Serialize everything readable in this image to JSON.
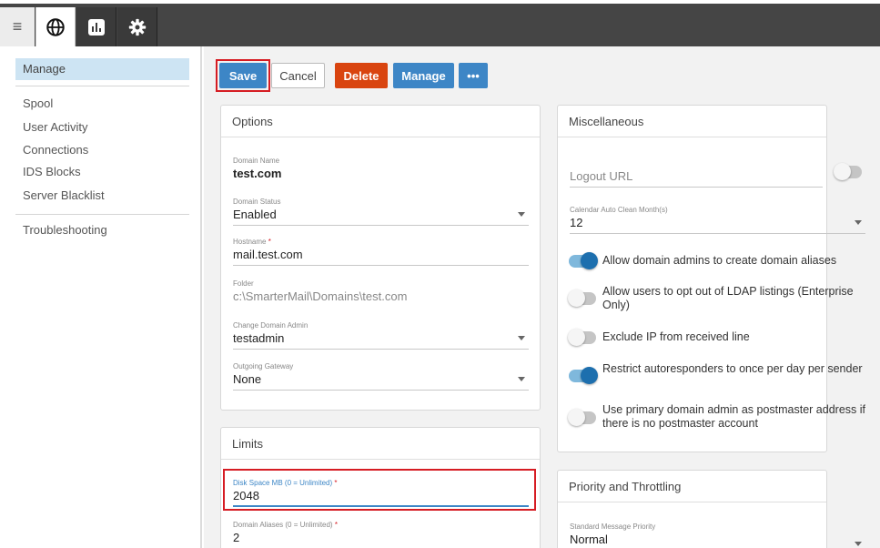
{
  "topbar": {
    "tabs": [
      {
        "name": "domains",
        "icon": "globe-icon",
        "active": true
      },
      {
        "name": "reports",
        "icon": "bar-chart-icon",
        "active": false
      },
      {
        "name": "settings",
        "icon": "gear-icon",
        "active": false
      }
    ]
  },
  "sidebar": {
    "items": [
      {
        "label": "Manage"
      },
      {
        "label": "Spool"
      },
      {
        "label": "User Activity"
      },
      {
        "label": "Connections"
      },
      {
        "label": "IDS Blocks"
      },
      {
        "label": "Server Blacklist"
      },
      {
        "label": "Troubleshooting"
      }
    ]
  },
  "toolbar": {
    "save": "Save",
    "cancel": "Cancel",
    "delete": "Delete",
    "manage": "Manage",
    "more": "•••"
  },
  "options": {
    "title": "Options",
    "domain_name": {
      "label": "Domain Name",
      "value": "test.com"
    },
    "domain_status": {
      "label": "Domain Status",
      "value": "Enabled"
    },
    "hostname": {
      "label": "Hostname",
      "value": "mail.test.com"
    },
    "folder": {
      "label": "Folder",
      "value": "c:\\SmarterMail\\Domains\\test.com"
    },
    "change_admin": {
      "label": "Change Domain Admin",
      "value": "testadmin"
    },
    "gateway": {
      "label": "Outgoing Gateway",
      "value": "None"
    }
  },
  "limits": {
    "title": "Limits",
    "disk_space": {
      "label": "Disk Space MB (0 = Unlimited)",
      "value": "2048"
    },
    "domain_aliases": {
      "label": "Domain Aliases (0 = Unlimited)",
      "value": "2"
    }
  },
  "misc": {
    "title": "Miscellaneous",
    "logout_url": {
      "placeholder": "Logout URL"
    },
    "calendar": {
      "label": "Calendar Auto Clean Month(s)",
      "value": "12"
    },
    "toggles": [
      {
        "label": "Allow domain admins to create domain aliases",
        "on": true
      },
      {
        "label": "Allow users to opt out of LDAP listings (Enterprise Only)",
        "on": false
      },
      {
        "label": "Exclude IP from received line",
        "on": false
      },
      {
        "label": "Restrict autoresponders to once per day per sender",
        "on": true
      },
      {
        "label": "Use primary domain admin as postmaster address if there is no postmaster account",
        "on": false
      }
    ]
  },
  "priority": {
    "title": "Priority and Throttling",
    "standard": {
      "label": "Standard Message Priority",
      "value": "Normal"
    }
  },
  "colors": {
    "primary": "#3d86c6",
    "danger": "#d9440f",
    "highlight": "#d61c23",
    "toggle_on": "#1d6fae"
  }
}
